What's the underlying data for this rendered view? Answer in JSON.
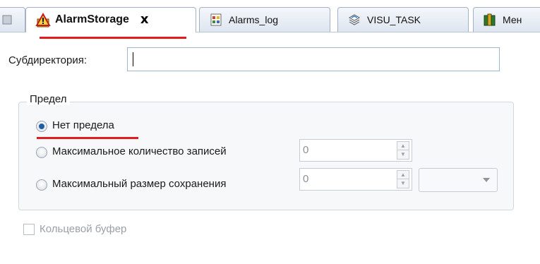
{
  "tabs": [
    {
      "label": "",
      "icon": "partial-tab-icon"
    },
    {
      "label": "AlarmStorage",
      "icon": "alarm-storage-icon",
      "active": true,
      "close_label": "x"
    },
    {
      "label": "Alarms_log",
      "icon": "alarms-log-icon"
    },
    {
      "label": "VISU_TASK",
      "icon": "visu-task-icon"
    },
    {
      "label": "Мен",
      "icon": "books-icon"
    }
  ],
  "subdirectory": {
    "label": "Субдиректория:",
    "value": ""
  },
  "limit_group": {
    "title": "Предел",
    "options": [
      {
        "label": "Нет предела",
        "checked": true
      },
      {
        "label": "Максимальное количество записей",
        "checked": false
      },
      {
        "label": "Максимальный размер сохранения",
        "checked": false
      }
    ],
    "max_records_value": "0",
    "max_size_value": "0",
    "size_unit": ""
  },
  "ring_buffer": {
    "label": "Кольцевой буфер",
    "checked": false
  },
  "colors": {
    "annotation": "#e21b1b",
    "radio_selected": "#1c5ea8"
  }
}
